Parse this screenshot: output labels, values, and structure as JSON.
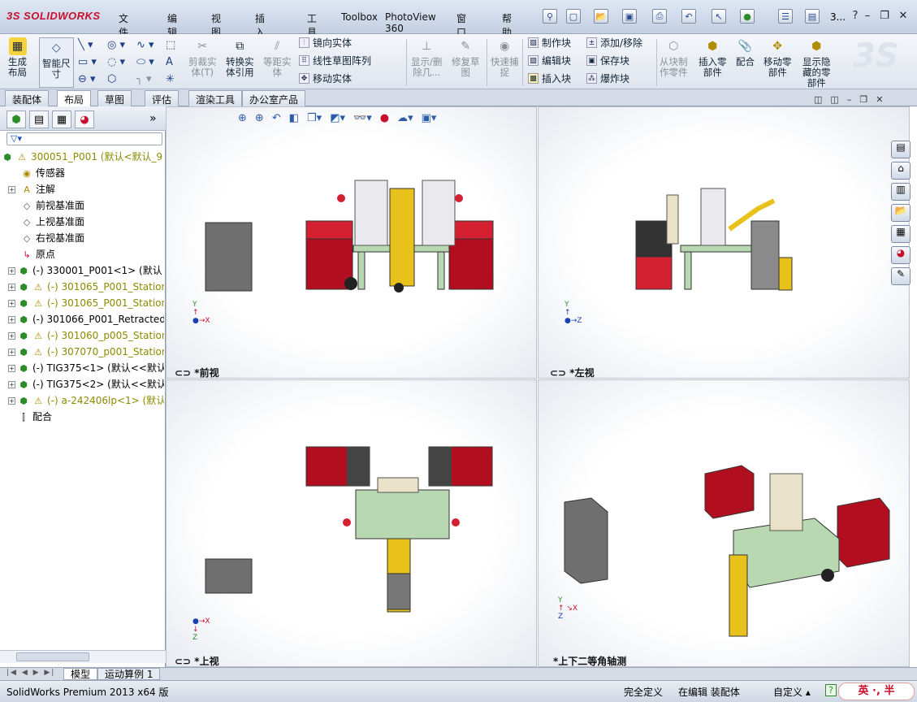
{
  "app": {
    "logo": "SOLIDWORKS",
    "logo_prefix": "3S",
    "title_short": "3..."
  },
  "menu": [
    "文件(F)",
    "编辑(E)",
    "视图(V)",
    "插入(I)",
    "工具(T)",
    "Toolbox",
    "PhotoView 360",
    "窗口(W)",
    "帮助(H)"
  ],
  "ribbon": {
    "generate_layout": "生成\n布局",
    "smart_dim": "智能尺\n寸",
    "trim": "剪裁实\n体(T)",
    "convert": "转换实\n体引用",
    "offset": "等距实\n体",
    "mirror": "镜向实体",
    "linear_pattern": "线性草图阵列",
    "move_entity": "移动实体",
    "show_delete": "显示/删\n除几...",
    "repair": "修复草\n图",
    "quick_snap": "快速捕\n捉",
    "make_block": "制作块",
    "edit_block": "编辑块",
    "insert_block": "插入块",
    "add_remove": "添加/移除",
    "save_block": "保存块",
    "explode_block": "爆炸块",
    "from_block": "从块制\n作零件",
    "insert_part": "插入零\n部件",
    "mate": "配合",
    "move_part": "移动零\n部件",
    "show_hidden": "显示隐\n藏的零\n部件"
  },
  "tabs": [
    "装配体",
    "布局",
    "草图",
    "评估",
    "渲染工具",
    "办公室产品"
  ],
  "active_tab": 1,
  "tree": {
    "filter_icon": "filter-icon",
    "root": "300051_P001 (默认<默认_9",
    "items": [
      {
        "label": "传感器",
        "indent": 1,
        "exp": false,
        "icon": "sensor",
        "color": "normal"
      },
      {
        "label": "注解",
        "indent": 1,
        "exp": true,
        "icon": "A",
        "color": "normal"
      },
      {
        "label": "前视基准面",
        "indent": 1,
        "exp": false,
        "icon": "plane",
        "color": "normal"
      },
      {
        "label": "上视基准面",
        "indent": 1,
        "exp": false,
        "icon": "plane",
        "color": "normal"
      },
      {
        "label": "右视基准面",
        "indent": 1,
        "exp": false,
        "icon": "plane",
        "color": "normal"
      },
      {
        "label": "原点",
        "indent": 1,
        "exp": false,
        "icon": "origin",
        "color": "normal"
      },
      {
        "label": "(-) 330001_P001<1> (默认",
        "indent": 0,
        "exp": true,
        "icon": "asm",
        "color": "normal"
      },
      {
        "label": "(-) 301065_P001_Station",
        "indent": 0,
        "exp": true,
        "icon": "asmwarn",
        "color": "olive"
      },
      {
        "label": "(-) 301065_P001_Station",
        "indent": 0,
        "exp": true,
        "icon": "asmwarn",
        "color": "olive"
      },
      {
        "label": "(-) 301066_P001_Retracted",
        "indent": 0,
        "exp": true,
        "icon": "asm",
        "color": "normal"
      },
      {
        "label": "(-) 301060_p005_Station",
        "indent": 0,
        "exp": true,
        "icon": "asmwarn",
        "color": "olive"
      },
      {
        "label": "(-) 307070_p001_Station",
        "indent": 0,
        "exp": true,
        "icon": "asmwarn",
        "color": "olive"
      },
      {
        "label": "(-) TIG375<1> (默认<<默认",
        "indent": 0,
        "exp": true,
        "icon": "asm",
        "color": "normal"
      },
      {
        "label": "(-) TIG375<2> (默认<<默认",
        "indent": 0,
        "exp": true,
        "icon": "asm",
        "color": "normal"
      },
      {
        "label": "(-) a-242406lp<1> (默认",
        "indent": 0,
        "exp": true,
        "icon": "asmwarn",
        "color": "olive"
      },
      {
        "label": "配合",
        "indent": 0,
        "exp": false,
        "icon": "mates",
        "color": "normal"
      }
    ]
  },
  "viewports": {
    "front": "*前视",
    "left": "*左视",
    "top": "*上视",
    "iso": "*上下二等角轴测"
  },
  "bottom_tabs": [
    "模型",
    "运动算例 1"
  ],
  "status": {
    "product": "SolidWorks Premium 2013 x64 版",
    "defined": "完全定义",
    "editing": "在编辑 装配体",
    "custom": "自定义",
    "help": "?",
    "ime": "英 ·, 半"
  },
  "colors": {
    "red": "#c8102e",
    "frame": "#b7d8b0",
    "gray": "#6f6f6f",
    "yellow": "#e8c21a"
  }
}
